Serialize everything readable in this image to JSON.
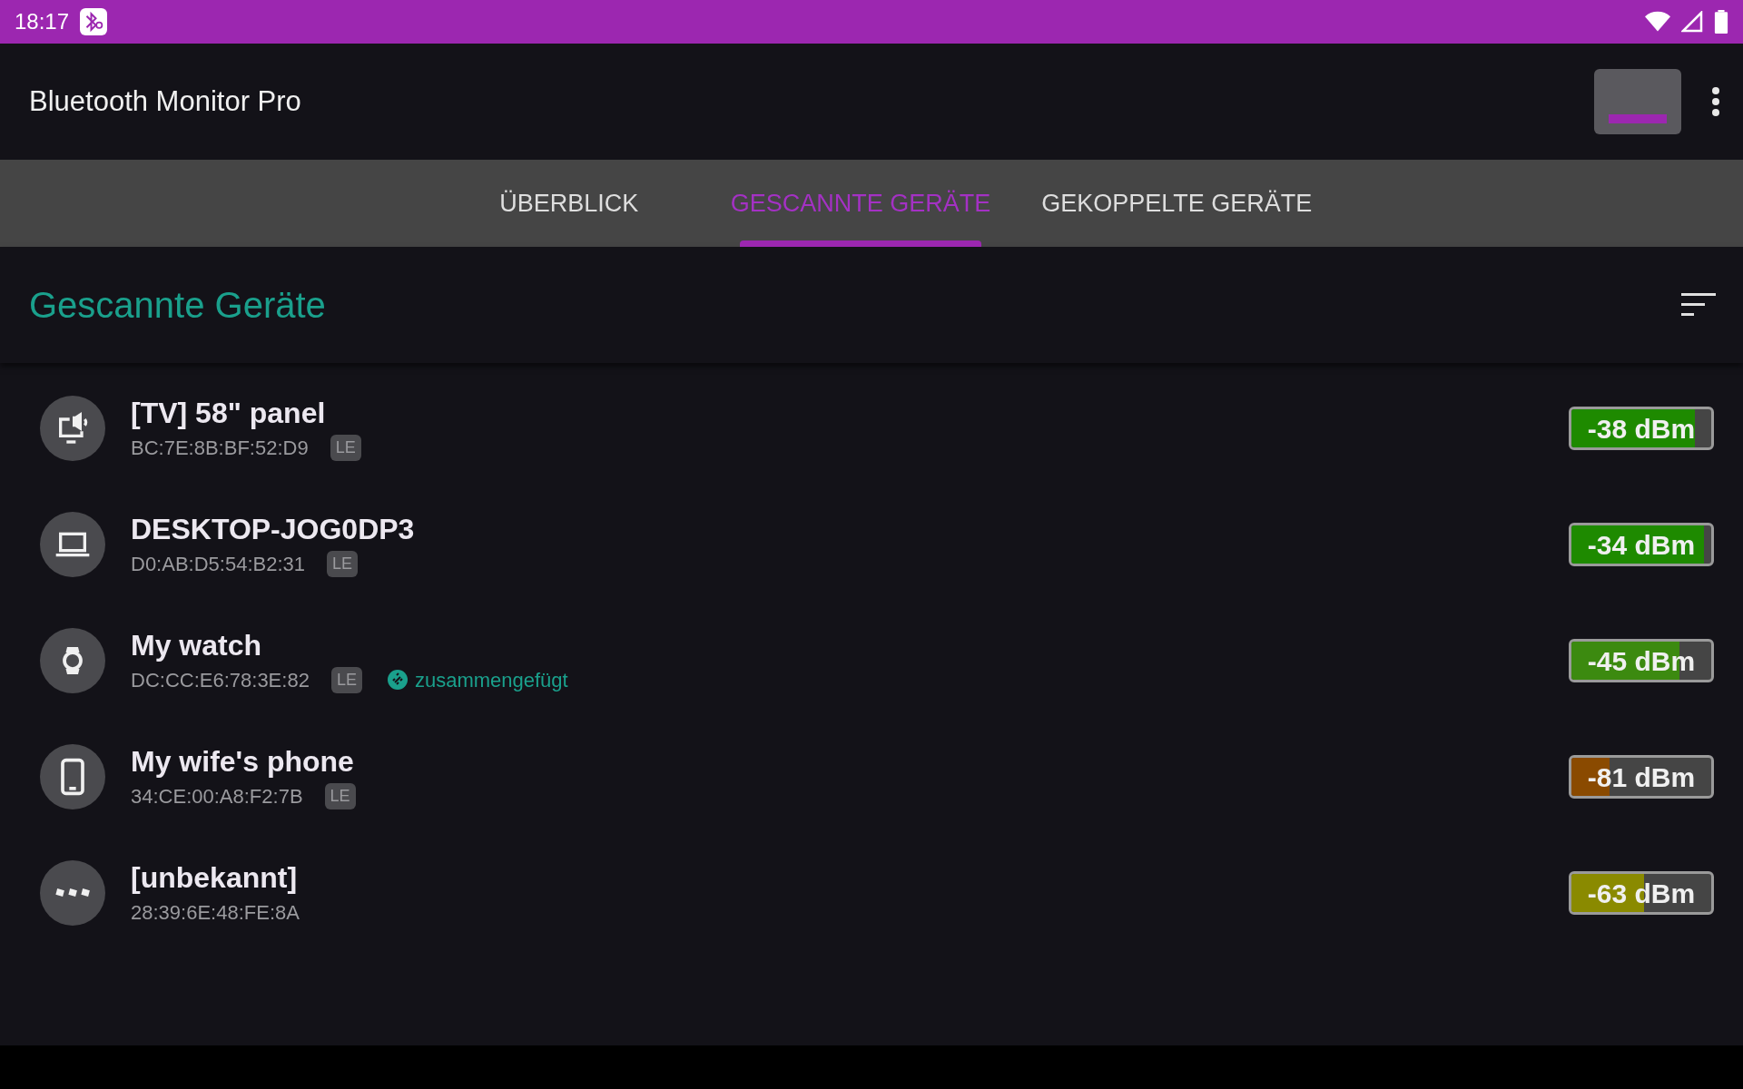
{
  "status_bar": {
    "time": "18:17"
  },
  "app_bar": {
    "title": "Bluetooth Monitor Pro"
  },
  "tabs": [
    {
      "label": "ÜBERBLICK",
      "selected": false
    },
    {
      "label": "GESCANNTE GERÄTE",
      "selected": true
    },
    {
      "label": "GEKOPPELTE GERÄTE",
      "selected": false
    }
  ],
  "section": {
    "title": "Gescannte Geräte"
  },
  "devices": [
    {
      "kind": "tv",
      "name": "[TV] 58\" panel",
      "address": "BC:7E:8B:BF:52:D9",
      "badge": "LE",
      "signal": {
        "reading": "-38 dBm",
        "level": 0.88,
        "color": "#1e8a00"
      }
    },
    {
      "kind": "laptop",
      "name": "DESKTOP-JOG0DP3",
      "address": "D0:AB:D5:54:B2:31",
      "badge": "LE",
      "signal": {
        "reading": "-34 dBm",
        "level": 0.95,
        "color": "#1e8a00"
      }
    },
    {
      "kind": "watch",
      "name": "My watch",
      "address": "DC:CC:E6:78:3E:82",
      "badge": "LE",
      "bonded": "zusammengefügt",
      "signal": {
        "reading": "-45 dBm",
        "level": 0.77,
        "color": "#3c8a10"
      }
    },
    {
      "kind": "phone",
      "name": "My wife's phone",
      "address": "34:CE:00:A8:F2:7B",
      "badge": "LE",
      "signal": {
        "reading": "-81 dBm",
        "level": 0.27,
        "color": "#8a4a00"
      }
    },
    {
      "kind": "unknown",
      "name": "[unbekannt]",
      "address": "28:39:6E:48:FE:8A",
      "signal": {
        "reading": "-63 dBm",
        "level": 0.52,
        "color": "#8a8a00"
      }
    }
  ]
}
